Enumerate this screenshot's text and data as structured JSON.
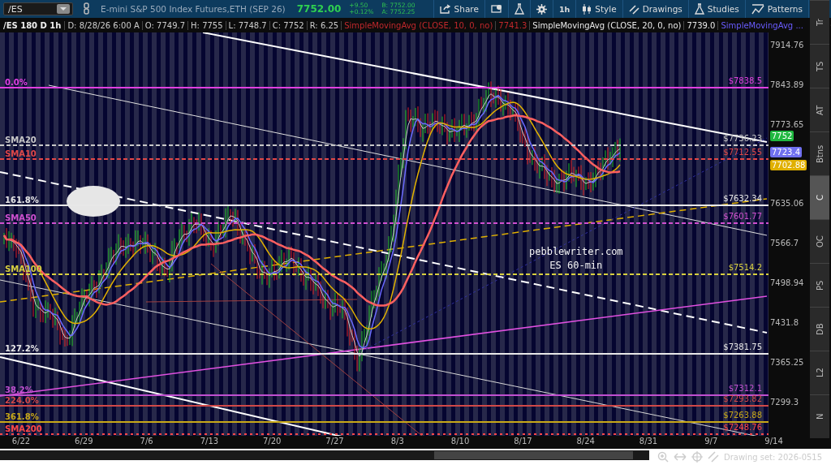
{
  "toolbar": {
    "symbol": "/ES",
    "description": "E-mini S&P 500 Index Futures,ETH (SEP 26)",
    "last": "7752.00",
    "change": "+9.50",
    "change_pct": "+0.12%",
    "bid": "B: 7752.00",
    "ask": "A: 7752.25",
    "buttons": [
      {
        "kind": "share",
        "label": "Share"
      },
      {
        "kind": "alert"
      },
      {
        "kind": "flask"
      },
      {
        "kind": "gear"
      },
      {
        "kind": "timeframe",
        "label": "1h"
      },
      {
        "kind": "style",
        "label": "Style"
      },
      {
        "kind": "drawings",
        "label": "Drawings"
      },
      {
        "kind": "studies",
        "label": "Studies"
      },
      {
        "kind": "patterns",
        "label": "Patterns"
      },
      {
        "kind": "menu"
      }
    ]
  },
  "info_bar": {
    "title": "/ES 180 D 1h",
    "fields": [
      "D: 8/28/26 6:00 A",
      "O: 7749.7",
      "H: 7755",
      "L: 7748.7",
      "C: 7752",
      "R: 6.25"
    ],
    "studies": [
      {
        "name": "SimpleMovingAvg (CLOSE, 10, 0, no)",
        "value": "7741.3",
        "color": "#c0282c"
      },
      {
        "name": "SimpleMovingAvg (CLOSE, 20, 0, no)",
        "value": "7739.0",
        "color": "#e8e8e8"
      },
      {
        "name": "SimpleMovingAvg ...",
        "color": "#6a5cff"
      }
    ]
  },
  "chart": {
    "levels": [
      {
        "left_label": "0.0%",
        "right_label": "$7838.5",
        "color": "#e040e0"
      },
      {
        "left_label": "SMA20",
        "right_label": "$7736.23",
        "color": "#c8c8c8"
      },
      {
        "left_label": "SMA10",
        "right_label": "$7712.55",
        "color": "#e04848"
      },
      {
        "left_label": "161.8%",
        "right_label": "$7632.34",
        "color": "#e8e8e8"
      },
      {
        "left_label": "SMA50",
        "right_label": "$7601.77",
        "color": "#d050d0"
      },
      {
        "left_label": "SMA100",
        "right_label": "$7514.2",
        "color": "#d8d040"
      },
      {
        "left_label": "127.2%",
        "right_label": "$7381.75",
        "color": "#e8e8e8"
      },
      {
        "left_label": "38.2%",
        "right_label": "$7312.1",
        "color": "#c050d0"
      },
      {
        "left_label": "224.0%",
        "right_label": "$7293.82",
        "color": "#d04848"
      },
      {
        "left_label": "361.8%",
        "right_label": "$7263.88",
        "color": "#c8a818"
      },
      {
        "left_label": "SMA200",
        "right_label": "$7248.76",
        "color": "#ff4848"
      }
    ],
    "annotation": [
      "pebblewriter.com",
      "ES 60-min"
    ],
    "price_axis": [
      "7914.76",
      "7843.89",
      "7773.65",
      "7635.06",
      "7566.7",
      "7498.94",
      "7431.8",
      "7365.25",
      "7299.3"
    ],
    "price_badges": [
      {
        "text": "7752",
        "color": "#1fb840"
      },
      {
        "text": "7723.4",
        "color": "#7070f0"
      },
      {
        "text": "7702.88",
        "color": "#e0b000"
      }
    ],
    "dates": [
      "6/22",
      "6/29",
      "7/6",
      "7/13",
      "7/20",
      "7/27",
      "8/3",
      "8/10",
      "8/17",
      "8/24",
      "8/31",
      "9/7",
      "9/14"
    ]
  },
  "side_tabs": [
    {
      "label": "Tr",
      "selected": false
    },
    {
      "label": "TS",
      "selected": false
    },
    {
      "label": "AT",
      "selected": false
    },
    {
      "label": "Btns",
      "selected": false
    },
    {
      "label": "C",
      "selected": true
    },
    {
      "label": "OC",
      "selected": false
    },
    {
      "label": "PS",
      "selected": false
    },
    {
      "label": "DB",
      "selected": false
    },
    {
      "label": "L2",
      "selected": false
    },
    {
      "label": "N",
      "selected": false
    }
  ],
  "footer": {
    "drawing_set": "Drawing set: 2026-0515"
  }
}
